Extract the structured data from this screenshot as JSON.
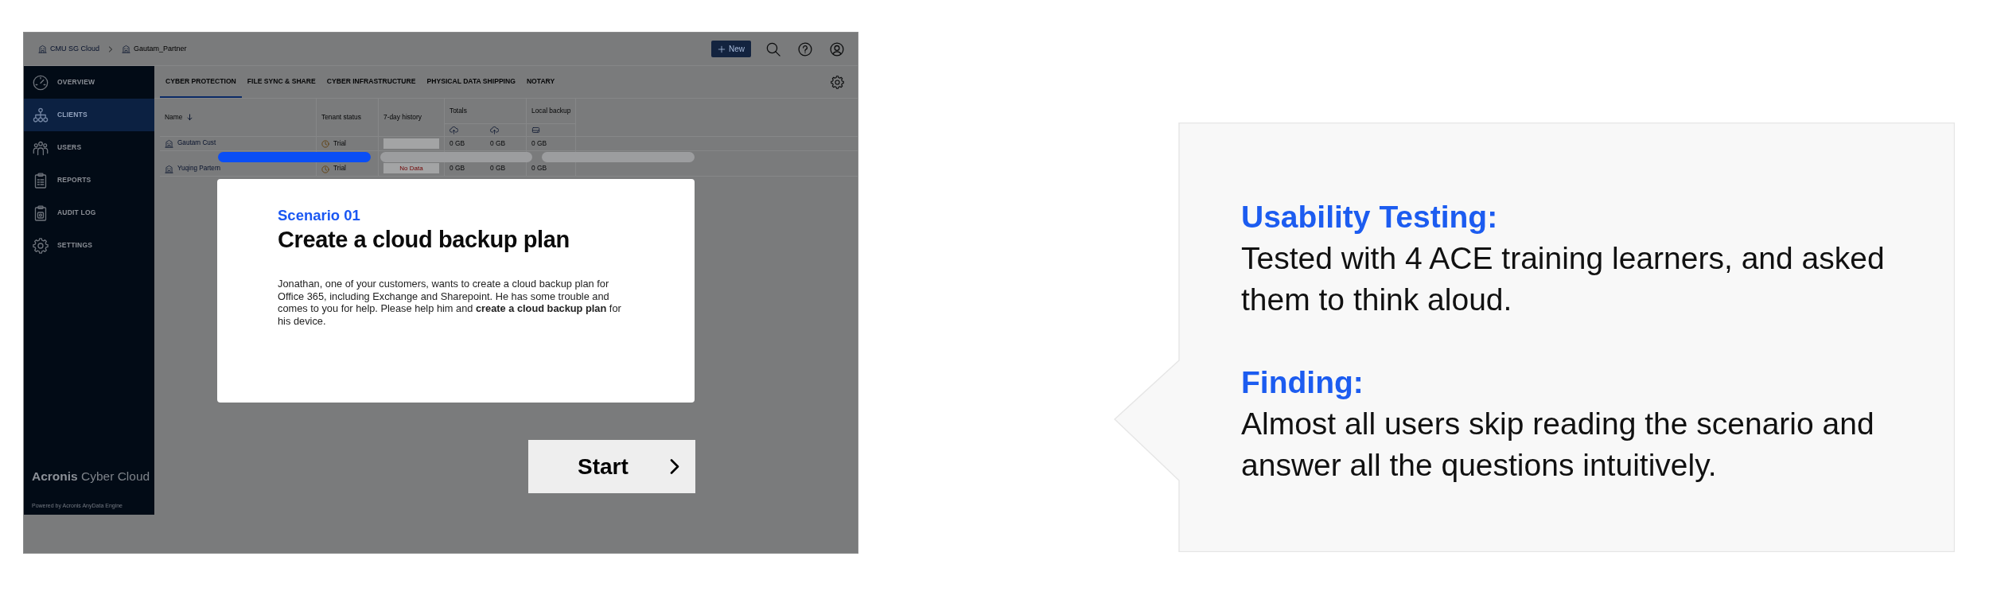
{
  "app": {
    "breadcrumb": [
      {
        "label": "CMU SG Cloud"
      },
      {
        "label": "Gautam_Partner"
      }
    ],
    "new_button": "New",
    "sidebar": {
      "items": [
        {
          "label": "OVERVIEW",
          "selected": false
        },
        {
          "label": "CLIENTS",
          "selected": true
        },
        {
          "label": "USERS",
          "selected": false
        },
        {
          "label": "REPORTS",
          "selected": false
        },
        {
          "label": "AUDIT LOG",
          "selected": false
        },
        {
          "label": "SETTINGS",
          "selected": false
        }
      ],
      "brand": "**Acronis** Cyber Cloud",
      "powered_by": "Powered by Acronis AnyData Engine"
    },
    "tabs": [
      {
        "label": "CYBER PROTECTION",
        "selected": true
      },
      {
        "label": "FILE SYNC & SHARE",
        "selected": false
      },
      {
        "label": "CYBER INFRASTRUCTURE",
        "selected": false
      },
      {
        "label": "PHYSICAL DATA SHIPPING",
        "selected": false
      },
      {
        "label": "NOTARY",
        "selected": false
      }
    ],
    "table": {
      "columns": [
        {
          "label": "Name",
          "sorted": true
        },
        {
          "label": "Tenant status",
          "sorted": false
        },
        {
          "label": "7-day history",
          "sorted": false
        },
        {
          "label": "Totals",
          "sorted": false
        },
        {
          "label": "Local backup",
          "sorted": false
        }
      ],
      "rows": [
        {
          "name": "Gautam Cust",
          "status": "Trial",
          "values": [
            "0 GB",
            "0 GB",
            "0 GB"
          ]
        },
        {
          "name": "Yuqing Partern",
          "status": "Trial",
          "history": "No Data",
          "values": [
            "0 GB",
            "0 GB",
            "0 GB"
          ]
        }
      ]
    }
  },
  "progress_steps": [
    {
      "done": true
    },
    {
      "done": false
    },
    {
      "done": false
    }
  ],
  "dialog": {
    "eyebrow": "Scenario 01",
    "title": "Create a cloud backup plan",
    "body": "Jonathan, one of your customers, wants to create a cloud backup plan for Office 365, including Exchange and Sharepoint. He has some trouble and comes to you for help. Please help him and **create a cloud backup plan** for his device."
  },
  "start_button": "Start",
  "callout": {
    "sections": [
      {
        "heading": "Usability Testing:",
        "text": "Tested with 4 ACE training learners, and asked them to think aloud."
      },
      {
        "heading": "Finding:",
        "text": "Almost all users skip reading the scenario and answer all the questions intuitively."
      }
    ]
  }
}
